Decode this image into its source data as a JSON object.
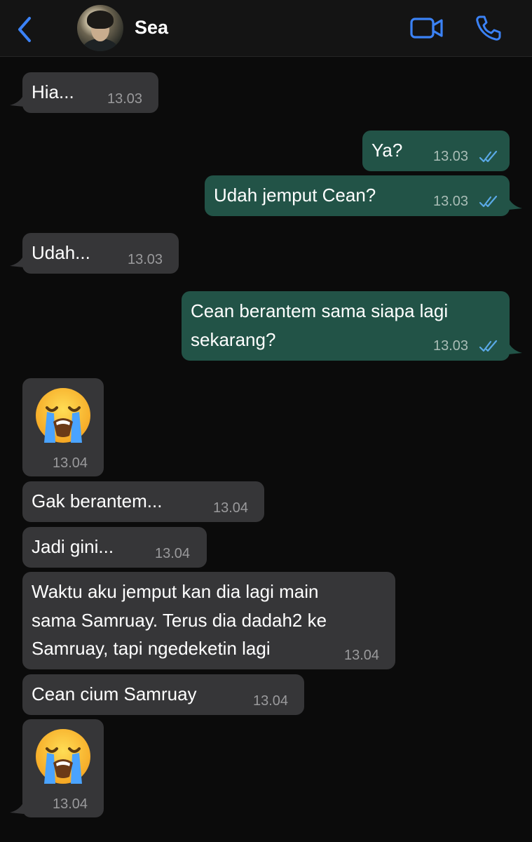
{
  "header": {
    "contact_name": "Sea"
  },
  "messages": [
    {
      "dir": "in",
      "text": "Hia...",
      "time": "13.03"
    },
    {
      "dir": "out",
      "text": "Ya?",
      "time": "13.03"
    },
    {
      "dir": "out",
      "text": "Udah jemput Cean?",
      "time": "13.03"
    },
    {
      "dir": "in",
      "text": "Udah...",
      "time": "13.03"
    },
    {
      "dir": "out",
      "text_line1": "Cean berantem sama siapa lagi",
      "text_line2": "sekarang?",
      "time": "13.03"
    },
    {
      "dir": "in",
      "emoji": "loudly-crying-face",
      "time": "13.04"
    },
    {
      "dir": "in",
      "text": "Gak berantem...",
      "time": "13.04"
    },
    {
      "dir": "in",
      "text": "Jadi gini...",
      "time": "13.04"
    },
    {
      "dir": "in",
      "text_line1": "Waktu aku jemput kan dia lagi main",
      "text_line2": "sama Samruay. Terus dia dadah2 ke",
      "text_line3": "Samruay, tapi ngedeketin lagi",
      "time": "13.04"
    },
    {
      "dir": "in",
      "text": "Cean cium Samruay",
      "time": "13.04"
    },
    {
      "dir": "in",
      "emoji": "loudly-crying-face",
      "time": "13.04"
    }
  ],
  "colors": {
    "incoming_bubble": "#363638",
    "outgoing_bubble": "#225347",
    "accent": "#3b82f6",
    "read_ticks": "#5aa9e6"
  }
}
